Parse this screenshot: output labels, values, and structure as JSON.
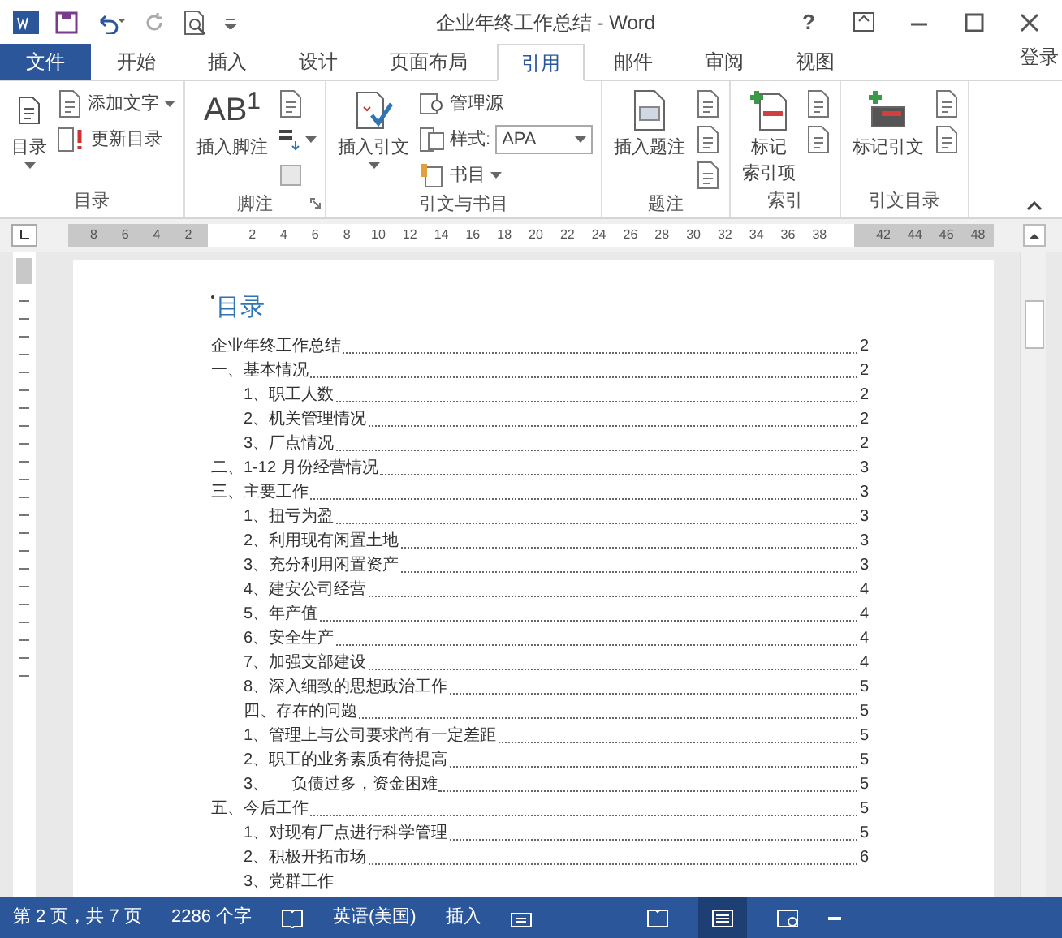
{
  "window": {
    "title": "企业年终工作总结 - Word",
    "help": "?"
  },
  "tabs": [
    {
      "label": "文件",
      "selected": false,
      "kind": "file"
    },
    {
      "label": "开始",
      "selected": false
    },
    {
      "label": "插入",
      "selected": false
    },
    {
      "label": "设计",
      "selected": false
    },
    {
      "label": "页面布局",
      "selected": false
    },
    {
      "label": "引用",
      "selected": true
    },
    {
      "label": "邮件",
      "selected": false
    },
    {
      "label": "审阅",
      "selected": false
    },
    {
      "label": "视图",
      "selected": false
    }
  ],
  "login": "登录",
  "ribbon": {
    "groups": [
      {
        "label": "目录",
        "large": [
          {
            "lines": [
              "目录"
            ],
            "dropdown": true
          }
        ],
        "small": [
          {
            "label": "添加文字",
            "dropdown": true
          },
          {
            "label": "更新目录"
          }
        ]
      },
      {
        "label": "脚注",
        "launcher": true,
        "large": [
          {
            "lines": [
              "插入脚注"
            ],
            "icon_text": "AB$^{1}$"
          }
        ]
      },
      {
        "label": "引文与书目",
        "large": [
          {
            "lines": [
              "插入引文"
            ],
            "dropdown": true
          }
        ],
        "small": [
          {
            "label": "管理源"
          },
          {
            "label": "样式:",
            "select": "APA"
          },
          {
            "label": "书目",
            "dropdown": true
          }
        ]
      },
      {
        "label": "题注",
        "large": [
          {
            "lines": [
              "插入题注"
            ]
          }
        ]
      },
      {
        "label": "索引",
        "large": [
          {
            "lines": [
              "标记",
              "索引项"
            ]
          }
        ]
      },
      {
        "label": "引文目录",
        "large": [
          {
            "lines": [
              "标记引文"
            ]
          }
        ]
      }
    ]
  },
  "ruler": [
    "8",
    "6",
    "4",
    "2",
    "2",
    "4",
    "6",
    "8",
    "10",
    "12",
    "14",
    "16",
    "18",
    "20",
    "22",
    "24",
    "26",
    "28",
    "30",
    "32",
    "34",
    "36",
    "38",
    "42",
    "44",
    "46",
    "48"
  ],
  "document": {
    "heading": "目录",
    "toc": [
      {
        "text": "企业年终工作总结",
        "page": "2"
      },
      {
        "text": "一、基本情况",
        "page": "2",
        "children": [
          {
            "text": "1、职工人数",
            "page": "2"
          },
          {
            "text": "2、机关管理情况",
            "page": "2"
          },
          {
            "text": "3、厂点情况",
            "page": "2"
          }
        ]
      },
      {
        "text": "二、1-12 月份经营情况",
        "page": "3"
      },
      {
        "text": "三、主要工作",
        "page": "3",
        "children": [
          {
            "text": "1、扭亏为盈",
            "page": "3"
          },
          {
            "text": "2、利用现有闲置土地",
            "page": "3"
          },
          {
            "text": "3、充分利用闲置资产",
            "page": "3"
          },
          {
            "text": "4、建安公司经营",
            "page": "4"
          },
          {
            "text": "5、年产值",
            "page": "4"
          },
          {
            "text": "6、安全生产",
            "page": "4"
          },
          {
            "text": "7、加强支部建设",
            "page": "4"
          },
          {
            "text": "8、深入细致的思想政治工作",
            "page": "5"
          },
          {
            "text": "四、存在的问题",
            "page": "5"
          },
          {
            "text": "1、管理上与公司要求尚有一定差距",
            "page": "5"
          },
          {
            "text": "2、职工的业务素质有待提高",
            "page": "5"
          },
          {
            "text": "3、     负债过多，资金困难",
            "page": "5"
          }
        ]
      },
      {
        "text": "五、今后工作",
        "page": "5",
        "children": [
          {
            "text": "1、对现有厂点进行科学管理",
            "page": "5"
          },
          {
            "text": "2、积极开拓市场",
            "page": "6"
          },
          {
            "text": "3、党群工作"
          }
        ]
      }
    ]
  },
  "status_bar": {
    "page": "第 2 页，共 7 页",
    "words": "2286 个字",
    "language": "英语(美国)",
    "mode": "插入"
  }
}
